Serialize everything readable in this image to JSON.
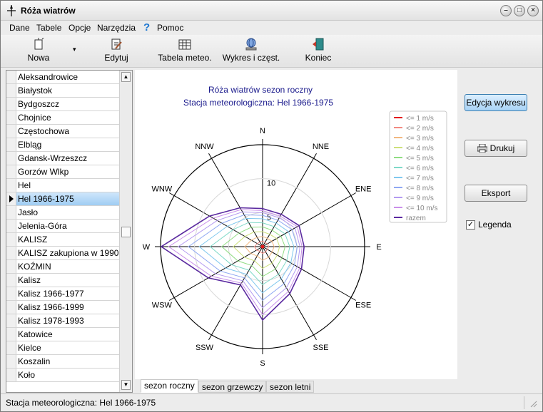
{
  "window": {
    "title": "Róża wiatrów"
  },
  "menu": [
    "Dane",
    "Tabele",
    "Opcje",
    "Narzędzia",
    "Pomoc"
  ],
  "toolbar": {
    "new_label": "Nowa",
    "edit_label": "Edytuj",
    "table_label": "Tabela meteo.",
    "chart_label": "Wykres i częst.",
    "exit_label": "Koniec"
  },
  "stations": [
    "Aleksandrowice",
    "Białystok",
    "Bydgoszcz",
    "Chojnice",
    "Częstochowa",
    "Elbląg",
    "Gdansk-Wrzeszcz",
    "Gorzów Wlkp",
    "Hel",
    "Hel 1966-1975",
    "Jasło",
    "Jelenia-Góra",
    "KALISZ",
    "KALISZ  zakupiona w 1990",
    "KOŹMIN",
    "Kalisz",
    "Kalisz 1966-1977",
    "Kalisz 1966-1999",
    "Kalisz 1978-1993",
    "Katowice",
    "Kielce",
    "Koszalin",
    "Koło"
  ],
  "selected_station": "Hel 1966-1975",
  "chart": {
    "title_line1": "Róża wiatrów    sezon roczny",
    "title_line2": "Stacja meteorologiczna: Hel 1966-1975"
  },
  "tabs": [
    "sezon roczny",
    "sezon grzewczy",
    "sezon letni"
  ],
  "right_panel": {
    "edit_chart_label": "Edycja wykresu",
    "print_label": "Drukuj",
    "export_label": "Eksport",
    "legend_label": "Legenda",
    "legend_checked": true
  },
  "status": {
    "text": "Stacja meteorologiczna: Hel 1966-1975"
  },
  "chart_data": {
    "type": "radar",
    "directions": [
      "N",
      "NNE",
      "ENE",
      "E",
      "ESE",
      "SSE",
      "S",
      "SSW",
      "WSW",
      "W",
      "WNW",
      "NNW"
    ],
    "rmax": 15,
    "rings": [
      5,
      10
    ],
    "ring_labels": [
      "5",
      "10"
    ],
    "series": [
      {
        "name": "<= 1 m/s",
        "color": "#e31a1c",
        "values": [
          0.2,
          0.2,
          0.2,
          0.2,
          0.2,
          0.2,
          0.2,
          0.2,
          0.2,
          0.2,
          0.2,
          0.2
        ]
      },
      {
        "name": "<= 2 m/s",
        "color": "#f28b82",
        "values": [
          0.8,
          0.7,
          0.8,
          0.9,
          0.8,
          0.9,
          1.0,
          0.8,
          1.0,
          1.2,
          0.9,
          0.8
        ]
      },
      {
        "name": "<= 3 m/s",
        "color": "#f2b880",
        "values": [
          1.5,
          1.4,
          1.6,
          1.7,
          1.6,
          1.8,
          2.0,
          1.6,
          2.0,
          2.6,
          1.9,
          1.6
        ]
      },
      {
        "name": "<= 4 m/s",
        "color": "#cde07b",
        "values": [
          2.2,
          2.1,
          2.4,
          2.5,
          2.5,
          2.8,
          3.2,
          2.4,
          3.1,
          4.3,
          3.0,
          2.5
        ]
      },
      {
        "name": "<= 5 m/s",
        "color": "#90dc82",
        "values": [
          2.9,
          2.8,
          3.1,
          3.3,
          3.3,
          3.8,
          4.4,
          3.2,
          4.2,
          6.0,
          4.0,
          3.3
        ]
      },
      {
        "name": "<= 6 m/s",
        "color": "#7fd9c8",
        "values": [
          3.5,
          3.4,
          3.8,
          4.0,
          4.1,
          4.7,
          5.6,
          4.0,
          5.3,
          7.7,
          5.0,
          4.1
        ]
      },
      {
        "name": "<= 7 m/s",
        "color": "#80c8ee",
        "values": [
          4.1,
          4.0,
          4.4,
          4.6,
          4.8,
          5.5,
          6.8,
          4.7,
          6.3,
          9.3,
          6.0,
          4.8
        ]
      },
      {
        "name": "<= 8 m/s",
        "color": "#8fa8f2",
        "values": [
          4.6,
          4.5,
          5.0,
          5.1,
          5.4,
          6.3,
          7.9,
          5.3,
          7.2,
          10.9,
          6.9,
          5.4
        ]
      },
      {
        "name": "<= 9 m/s",
        "color": "#b39af0",
        "values": [
          5.0,
          4.9,
          5.5,
          5.5,
          5.9,
          7.0,
          9.0,
          5.8,
          8.0,
          12.4,
          7.7,
          5.9
        ]
      },
      {
        "name": "<= 10 m/s",
        "color": "#c98fea",
        "values": [
          5.3,
          5.2,
          5.9,
          5.8,
          6.3,
          7.6,
          10.0,
          6.2,
          8.7,
          13.8,
          8.4,
          6.3
        ]
      },
      {
        "name": "razem",
        "color": "#5b2aa0",
        "values": [
          5.6,
          5.5,
          6.2,
          6.1,
          6.6,
          8.0,
          10.8,
          6.5,
          9.2,
          14.9,
          9.0,
          6.6
        ]
      }
    ]
  }
}
